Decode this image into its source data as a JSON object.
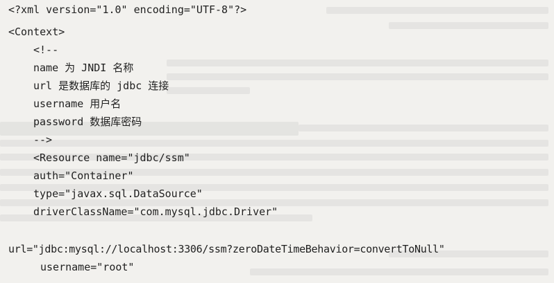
{
  "code_lines": [
    "<?xml version=\"1.0\" encoding=\"UTF-8\"?>",
    "<Context>",
    "<!--",
    "name 为 JNDI 名称",
    "url 是数据库的 jdbc 连接",
    "username 用户名",
    "password 数据库密码",
    "-->",
    "<Resource name=\"jdbc/ssm\"",
    "auth=\"Container\"",
    "type=\"javax.sql.DataSource\"",
    "driverClassName=\"com.mysql.jdbc.Driver\"",
    "url=\"jdbc:mysql://localhost:3306/ssm?zeroDateTimeBehavior=convertToNull\"",
    "username=\"root\""
  ]
}
